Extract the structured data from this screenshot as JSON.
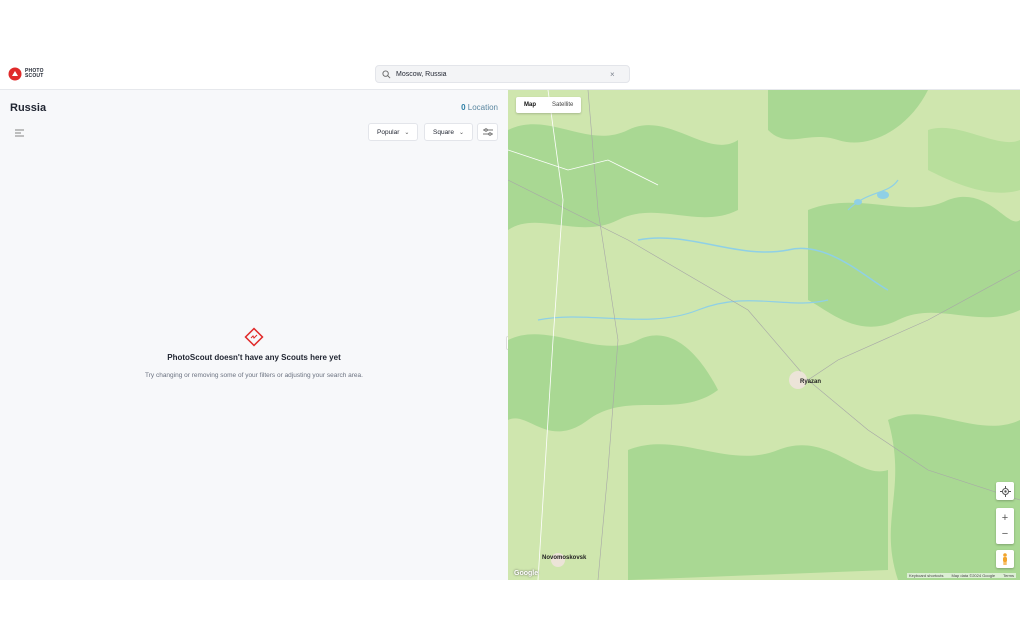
{
  "header": {
    "logo_text": "PHOTO SCOUT",
    "search_value": "Moscow, Russia",
    "clear_glyph": "×"
  },
  "sidebar": {
    "title": "Russia",
    "location_count": "0",
    "location_label": "Location",
    "sort_dropdown": "Popular",
    "shape_dropdown": "Square",
    "empty_title": "PhotoScout doesn't have any Scouts here yet",
    "empty_subtitle": "Try changing or removing some of your filters or adjusting your search area."
  },
  "map": {
    "tabs": [
      "Map",
      "Satellite"
    ],
    "active_tab": "Map",
    "city_labels": [
      "Ryazan",
      "Novomoskovsk"
    ],
    "footer": [
      "Keyboard shortcuts",
      "Map data ©2024 Google",
      "Terms"
    ],
    "google_mark": "Google",
    "zoom_in": "+",
    "zoom_out": "−"
  },
  "colors": {
    "brand": "#e02a2a",
    "accent": "#2d7fa5",
    "map_base": "#cfe6ae",
    "map_forest": "#9fd18a",
    "map_water": "#8fd0e6"
  }
}
